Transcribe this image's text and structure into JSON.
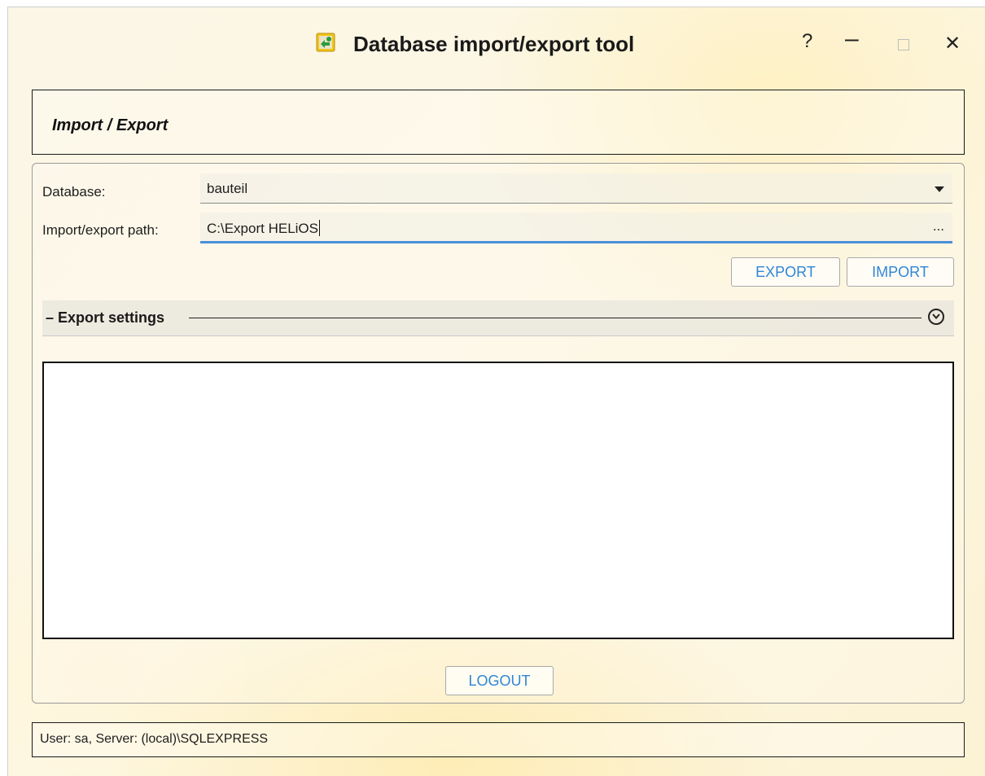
{
  "window": {
    "title": "Database import/export tool",
    "help_label": "?",
    "minimize_label": "–",
    "close_label": "✕"
  },
  "header": {
    "title": "Import / Export"
  },
  "form": {
    "database_label": "Database:",
    "database_value": "bauteil",
    "path_label": "Import/export path:",
    "path_value": "C:\\Export HELiOS",
    "browse_label": "...",
    "export_label": "EXPORT",
    "import_label": "IMPORT"
  },
  "settings": {
    "label": "– Export settings"
  },
  "footer": {
    "logout_label": "LOGOUT"
  },
  "status": {
    "text": "User: sa, Server: (local)\\SQLEXPRESS"
  },
  "colors": {
    "accent": "#2f86d6",
    "focus_underline": "#4a90d9"
  }
}
